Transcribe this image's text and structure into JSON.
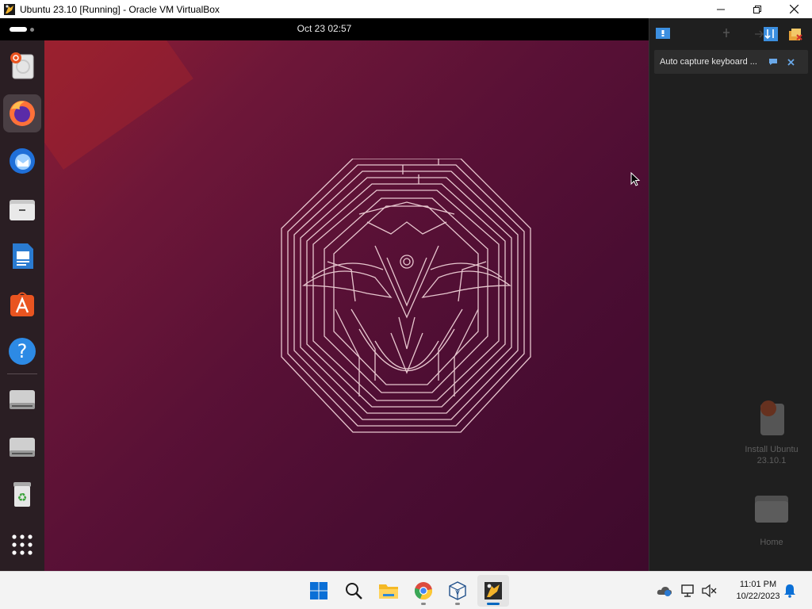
{
  "window": {
    "title": "Ubuntu 23.10 [Running] - Oracle VM VirtualBox",
    "controls": [
      "minimize-icon",
      "restore-icon",
      "close-icon"
    ]
  },
  "guest": {
    "clock": "Oct 23  02:57",
    "dock_items": [
      {
        "name": "install-ubuntu",
        "icon": "ubuntu-installer-icon"
      },
      {
        "name": "firefox",
        "icon": "firefox-icon",
        "active": true
      },
      {
        "name": "thunderbird",
        "icon": "thunderbird-icon"
      },
      {
        "name": "files",
        "icon": "files-icon"
      },
      {
        "name": "writer",
        "icon": "libreoffice-writer-icon"
      },
      {
        "name": "app-center",
        "icon": "app-center-icon"
      },
      {
        "name": "help",
        "icon": "help-icon"
      },
      {
        "name": "drive-1",
        "icon": "drive-icon"
      },
      {
        "name": "drive-2",
        "icon": "drive-icon"
      },
      {
        "name": "trash",
        "icon": "trash-icon"
      },
      {
        "name": "show-apps",
        "icon": "app-grid-icon"
      }
    ],
    "accent": "#e95420"
  },
  "side_panel": {
    "notice_text": "Auto capture keyboard ...",
    "desktop_icons": [
      {
        "label": "Install Ubuntu 23.10.1"
      },
      {
        "label": "Home"
      }
    ]
  },
  "taskbar": {
    "time": "11:01 PM",
    "date": "10/22/2023",
    "apps": [
      "windows-start-icon",
      "search-icon",
      "file-explorer-icon",
      "chrome-icon",
      "virtualbox-icon",
      "virtualbox-vm-icon"
    ]
  }
}
